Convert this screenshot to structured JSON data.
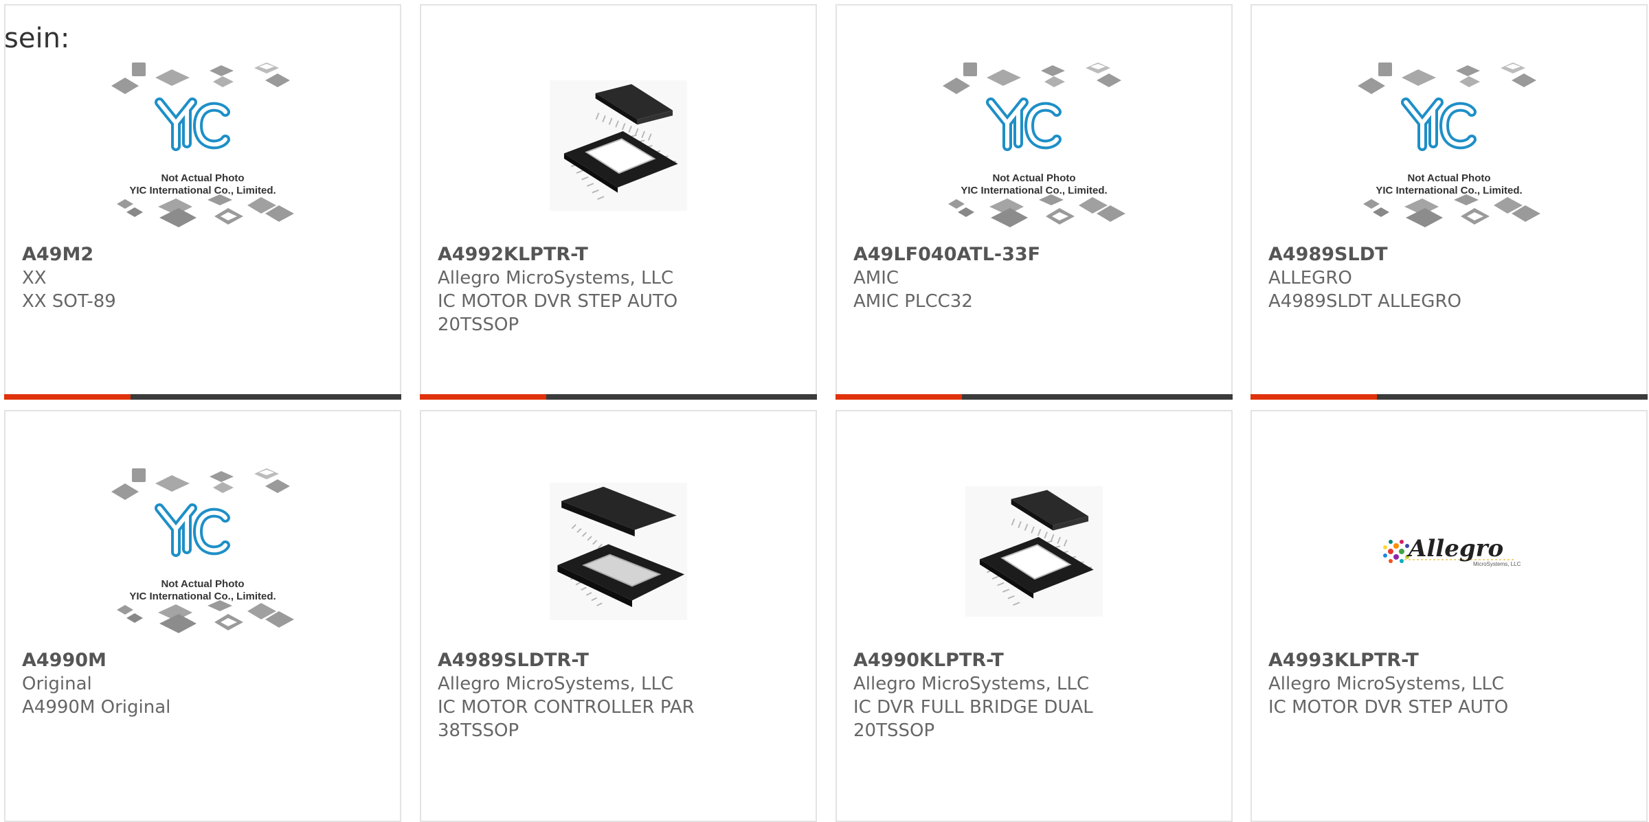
{
  "page": {
    "prefix_text": "sein:"
  },
  "colors": {
    "accent": "#e0330b",
    "bar": "#3b3b3b",
    "card_border": "#e3e3e3",
    "yic_blue": "#1e8fc7"
  },
  "placeholder": {
    "icon": "yic-logo-placeholder",
    "logo_text": "YIC",
    "line1": "Not Actual Photo",
    "line2": "YIC International Co., Limited."
  },
  "allegro_logo": {
    "icon": "allegro-logo",
    "text": "Allegro",
    "sub": "MicroSystems, LLC"
  },
  "products": [
    {
      "part": "A49M2",
      "manufacturer": "XX",
      "description": "XX SOT-89",
      "image": "placeholder"
    },
    {
      "part": "A4992KLPTR-T",
      "manufacturer": "Allegro MicroSystems, LLC",
      "description": "IC MOTOR DVR STEP AUTO 20TSSOP",
      "image": "tssop-20-chip"
    },
    {
      "part": "A49LF040ATL-33F",
      "manufacturer": "AMIC",
      "description": "AMIC PLCC32",
      "image": "placeholder"
    },
    {
      "part": "A4989SLDT",
      "manufacturer": "ALLEGRO",
      "description": "A4989SLDT ALLEGRO",
      "image": "placeholder"
    },
    {
      "part": "A4990M",
      "manufacturer": "Original",
      "description": "A4990M Original",
      "image": "placeholder"
    },
    {
      "part": "A4989SLDTR-T",
      "manufacturer": "Allegro MicroSystems, LLC",
      "description": "IC MOTOR CONTROLLER PAR 38TSSOP",
      "image": "tssop-38-chip"
    },
    {
      "part": "A4990KLPTR-T",
      "manufacturer": "Allegro MicroSystems, LLC",
      "description": "IC DVR FULL BRIDGE DUAL 20TSSOP",
      "image": "tssop-20-chip"
    },
    {
      "part": "A4993KLPTR-T",
      "manufacturer": "Allegro MicroSystems, LLC",
      "description": "IC MOTOR DVR STEP AUTO",
      "image": "allegro-logo"
    }
  ]
}
